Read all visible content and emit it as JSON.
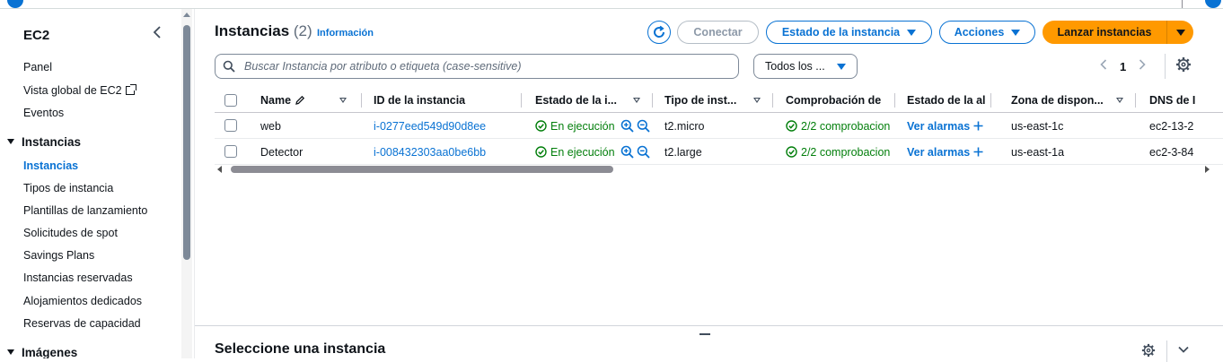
{
  "sidebar": {
    "title": "EC2",
    "items": [
      {
        "label": "Panel"
      },
      {
        "label": "Vista global de EC2"
      },
      {
        "label": "Eventos"
      }
    ],
    "section_instancias": "Instancias",
    "instancias_items": [
      {
        "label": "Instancias",
        "active": true
      },
      {
        "label": "Tipos de instancia"
      },
      {
        "label": "Plantillas de lanzamiento"
      },
      {
        "label": "Solicitudes de spot"
      },
      {
        "label": "Savings Plans"
      },
      {
        "label": "Instancias reservadas"
      },
      {
        "label": "Alojamientos dedicados"
      },
      {
        "label": "Reservas de capacidad"
      }
    ],
    "section_imagenes": "Imágenes"
  },
  "header": {
    "title": "Instancias",
    "count": "(2)",
    "info": "Información",
    "buttons": {
      "connect": "Conectar",
      "instance_state": "Estado de la instancia",
      "actions": "Acciones",
      "launch": "Lanzar instancias"
    }
  },
  "filter": {
    "search_placeholder": "Buscar Instancia por atributo o etiqueta (case-sensitive)",
    "state_select": "Todos los ..."
  },
  "pagination": {
    "page": "1"
  },
  "table": {
    "columns": [
      "Name",
      "ID de la instancia",
      "Estado de la i...",
      "Tipo de inst...",
      "Comprobación de",
      "Estado de la al",
      "Zona de dispon...",
      "DNS de I"
    ],
    "rows": [
      {
        "name": "web",
        "id": "i-0277eed549d90d8ee",
        "state": "En ejecución",
        "type": "t2.micro",
        "check": "2/2 comprobacion",
        "alarm": "Ver alarmas",
        "zone": "us-east-1c",
        "dns": "ec2-13-2"
      },
      {
        "name": "Detector",
        "id": "i-008432303aa0be6bb",
        "state": "En ejecución",
        "type": "t2.large",
        "check": "2/2 comprobacion",
        "alarm": "Ver alarmas",
        "zone": "us-east-1a",
        "dns": "ec2-3-84"
      }
    ]
  },
  "bottom_panel": {
    "title": "Seleccione una instancia"
  },
  "colors": {
    "accent": "#0972d3",
    "primary": "#ff9900",
    "success": "#037f0c"
  }
}
